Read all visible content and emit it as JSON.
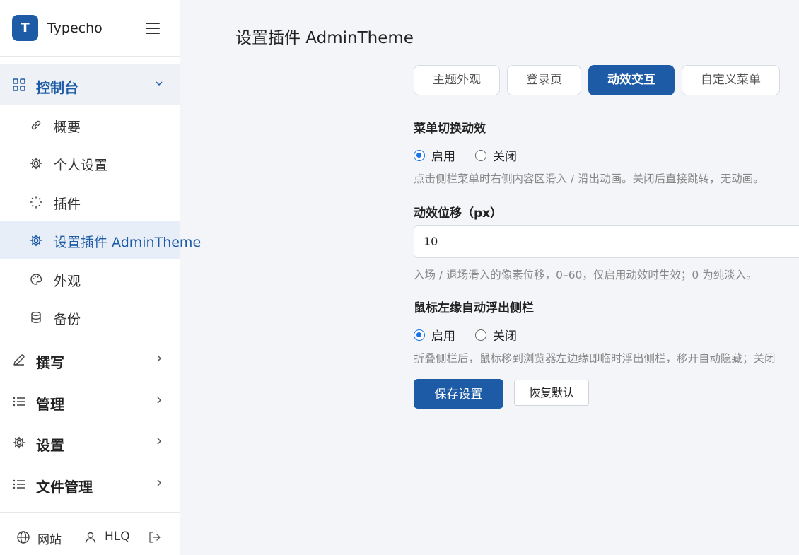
{
  "brand": {
    "logo_letter": "T",
    "name": "Typecho"
  },
  "sidebar": {
    "dashboard": "控制台",
    "sub_items": [
      "概要",
      "个人设置",
      "插件",
      "设置插件 AdminTheme",
      "外观",
      "备份"
    ],
    "write": "撰写",
    "manage": "管理",
    "settings": "设置",
    "files": "文件管理"
  },
  "footer": {
    "site": "网站",
    "user": "HLQ"
  },
  "page": {
    "title": "设置插件 AdminTheme"
  },
  "tabs": [
    {
      "label": "主题外观",
      "active": false
    },
    {
      "label": "登录页",
      "active": false
    },
    {
      "label": "动效交互",
      "active": true
    },
    {
      "label": "自定义菜单",
      "active": false
    }
  ],
  "form": {
    "menu_anim": {
      "label": "菜单切换动效",
      "on": "启用",
      "off": "关闭",
      "selected": "启用",
      "help": "点击侧栏菜单时右侧内容区滑入 / 滑出动画。关闭后直接跳转，无动画。"
    },
    "offset": {
      "label": "动效位移（px）",
      "value": "10",
      "help": "入场 / 退场滑入的像素位移，0–60，仅启用动效时生效；0 为纯淡入。"
    },
    "edge_float": {
      "label": "鼠标左缘自动浮出侧栏",
      "on": "启用",
      "off": "关闭",
      "selected": "启用",
      "help": "折叠侧栏后，鼠标移到浏览器左边缘即临时浮出侧栏，移开自动隐藏；关闭"
    },
    "save": "保存设置",
    "reset": "恢复默认"
  },
  "colors": {
    "primary": "#1e5ba7",
    "radio": "#1a73e8"
  }
}
